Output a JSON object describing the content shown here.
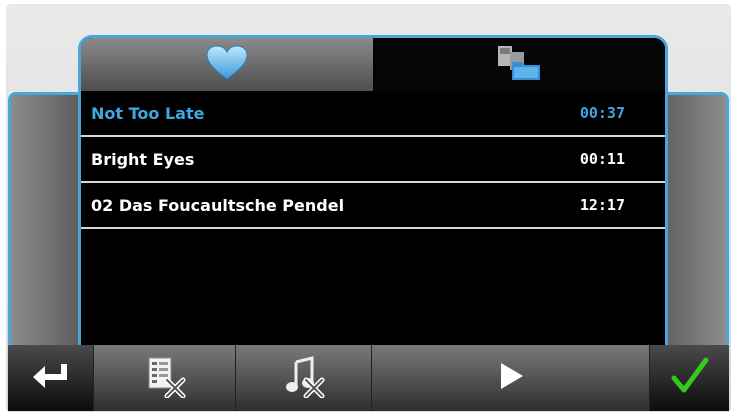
{
  "tabs": [
    {
      "id": "favorites",
      "icon": "heart-icon",
      "active": false
    },
    {
      "id": "folders",
      "icon": "folder-icon",
      "active": true
    }
  ],
  "playlist": {
    "items": [
      {
        "title": "Not Too Late",
        "duration": "00:37",
        "selected": true
      },
      {
        "title": "Bright Eyes",
        "duration": "00:11",
        "selected": false
      },
      {
        "title": "02 Das Foucaultsche Pendel",
        "duration": "12:17",
        "selected": false
      }
    ]
  },
  "toolbar": {
    "buttons": [
      {
        "id": "back",
        "icon": "return-arrow-icon"
      },
      {
        "id": "delete-list",
        "icon": "delete-playlist-icon"
      },
      {
        "id": "delete-song",
        "icon": "delete-song-icon"
      },
      {
        "id": "play",
        "icon": "play-icon"
      },
      {
        "id": "ok",
        "icon": "checkmark-icon"
      }
    ]
  },
  "colors": {
    "accent": "#4aa6d8",
    "selected_text": "#3ea7e3",
    "text": "#ffffff",
    "check": "#35c81f"
  }
}
